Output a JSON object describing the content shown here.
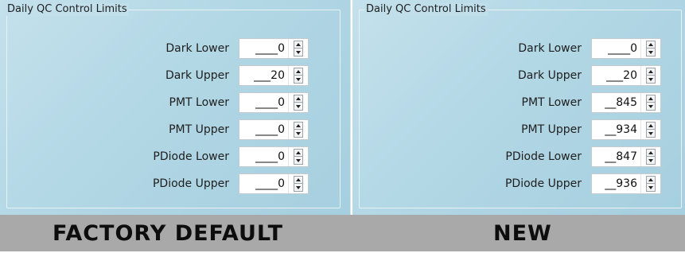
{
  "panels": [
    {
      "title": "Daily QC Control Limits",
      "fields": [
        {
          "label": "Dark Lower",
          "value": "____0"
        },
        {
          "label": "Dark Upper",
          "value": "___20"
        },
        {
          "label": "PMT Lower",
          "value": "____0"
        },
        {
          "label": "PMT Upper",
          "value": "____0"
        },
        {
          "label": "PDiode Lower",
          "value": "____0"
        },
        {
          "label": "PDiode Upper",
          "value": "____0"
        }
      ],
      "caption": "FACTORY DEFAULT"
    },
    {
      "title": "Daily QC Control Limits",
      "fields": [
        {
          "label": "Dark Lower",
          "value": "____0"
        },
        {
          "label": "Dark Upper",
          "value": "___20"
        },
        {
          "label": "PMT Lower",
          "value": "__845"
        },
        {
          "label": "PMT Upper",
          "value": "__934"
        },
        {
          "label": "PDiode Lower",
          "value": "__847"
        },
        {
          "label": "PDiode Upper",
          "value": "__936"
        }
      ],
      "caption": "NEW"
    }
  ],
  "colors": {
    "panel_bg": "#b2d7e5",
    "caption_bar": "#a9a9a9"
  },
  "icons": {
    "spin_up": "triangle-up-icon",
    "spin_down": "triangle-down-icon"
  }
}
